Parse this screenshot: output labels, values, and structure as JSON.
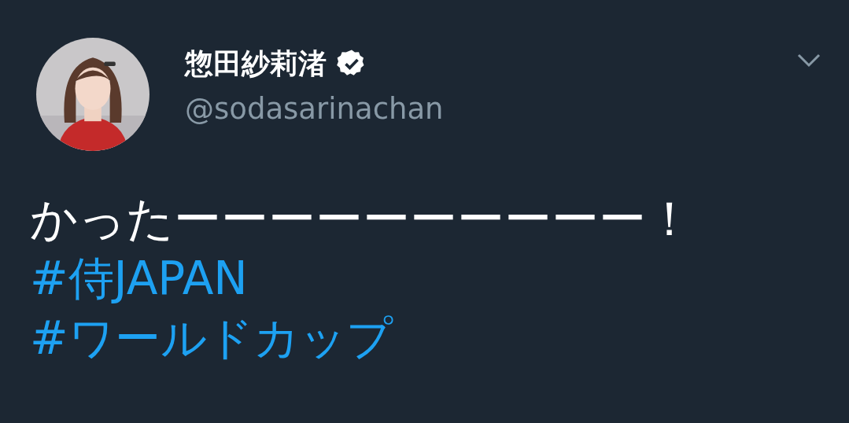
{
  "tweet": {
    "author": {
      "name": "惣田紗莉渚",
      "verified": true,
      "handle": "@sodasarinachan"
    },
    "text": "かったーーーーーーーーーー！",
    "hashtags": [
      "#侍JAPAN",
      "#ワールドカップ"
    ]
  }
}
